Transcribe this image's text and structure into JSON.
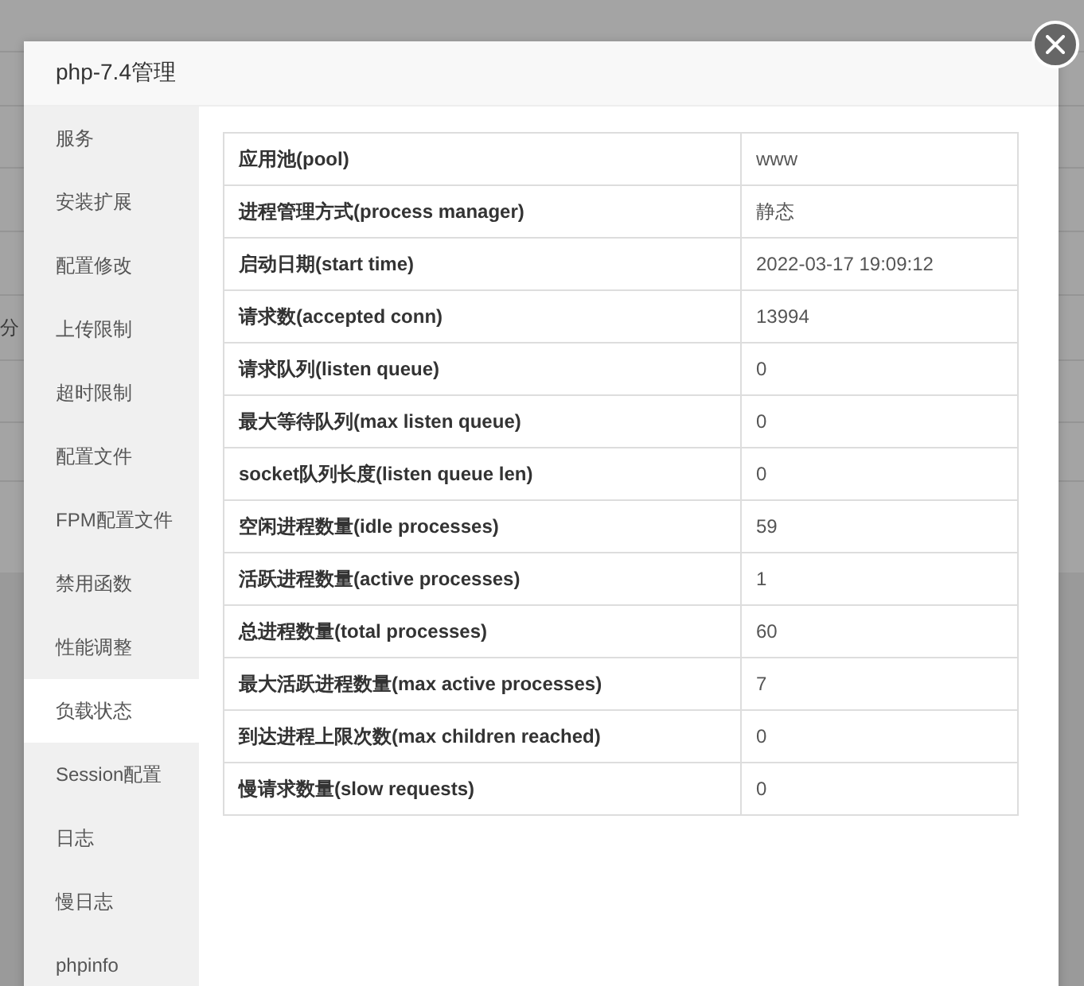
{
  "background_page": {
    "text": "分"
  },
  "dialog": {
    "title": "php-7.4管理"
  },
  "sidebar": {
    "items": [
      {
        "label": "服务",
        "selected": false
      },
      {
        "label": "安装扩展",
        "selected": false
      },
      {
        "label": "配置修改",
        "selected": false
      },
      {
        "label": "上传限制",
        "selected": false
      },
      {
        "label": "超时限制",
        "selected": false
      },
      {
        "label": "配置文件",
        "selected": false
      },
      {
        "label": "FPM配置文件",
        "selected": false
      },
      {
        "label": "禁用函数",
        "selected": false
      },
      {
        "label": "性能调整",
        "selected": false
      },
      {
        "label": "负载状态",
        "selected": true
      },
      {
        "label": "Session配置",
        "selected": false
      },
      {
        "label": "日志",
        "selected": false
      },
      {
        "label": "慢日志",
        "selected": false
      },
      {
        "label": "phpinfo",
        "selected": false
      }
    ]
  },
  "table": {
    "rows": [
      {
        "label": "应用池(pool)",
        "value": "www"
      },
      {
        "label": "进程管理方式(process manager)",
        "value": "静态"
      },
      {
        "label": "启动日期(start time)",
        "value": "2022-03-17 19:09:12"
      },
      {
        "label": "请求数(accepted conn)",
        "value": "13994"
      },
      {
        "label": "请求队列(listen queue)",
        "value": "0"
      },
      {
        "label": "最大等待队列(max listen queue)",
        "value": "0"
      },
      {
        "label": "socket队列长度(listen queue len)",
        "value": "0"
      },
      {
        "label": "空闲进程数量(idle processes)",
        "value": "59"
      },
      {
        "label": "活跃进程数量(active processes)",
        "value": "1"
      },
      {
        "label": "总进程数量(total processes)",
        "value": "60"
      },
      {
        "label": "最大活跃进程数量(max active processes)",
        "value": "7"
      },
      {
        "label": "到达进程上限次数(max children reached)",
        "value": "0"
      },
      {
        "label": "慢请求数量(slow requests)",
        "value": "0"
      }
    ]
  }
}
